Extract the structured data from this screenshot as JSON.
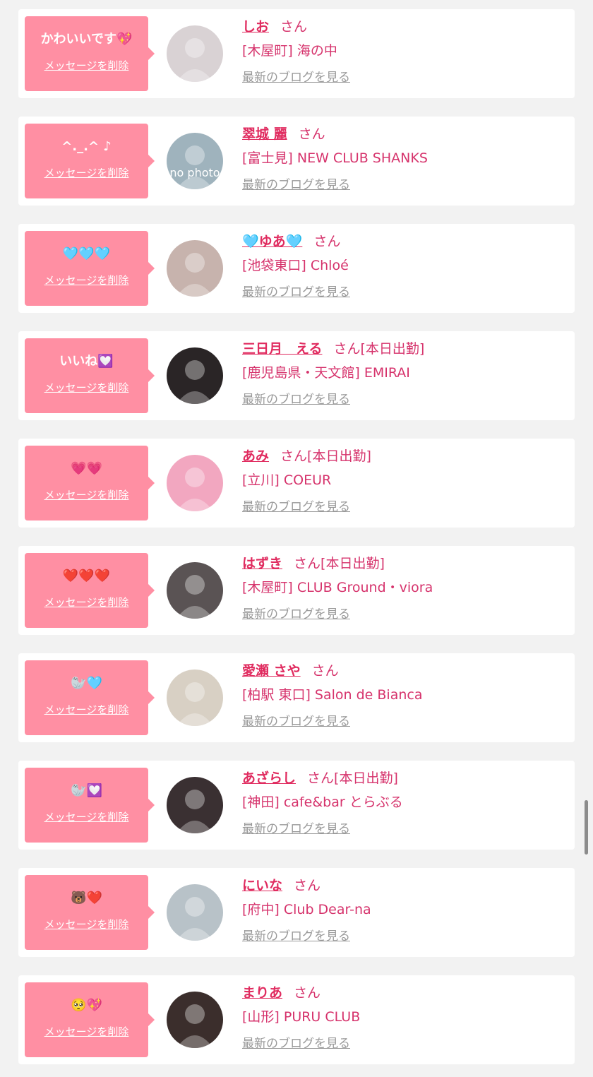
{
  "labels": {
    "delete": "メッセージを削除",
    "san": "さん",
    "blog": "最新のブログを見る"
  },
  "cards": [
    {
      "message": "かわいいです💖",
      "name": "しお",
      "status": "",
      "shop": "[木屋町] 海の中",
      "avatar_color": "#d9d2d4",
      "avatar_text": ""
    },
    {
      "message": "^._.^ ♪",
      "name": "翠城 麗",
      "status": "",
      "shop": "[富士見] NEW CLUB SHANKS",
      "avatar_color": "#9fb3bd",
      "avatar_text": "no photo"
    },
    {
      "message": "🩵🩵🩵",
      "name": "🩵ゆあ🩵",
      "status": "",
      "shop": "[池袋東口] Chloé",
      "avatar_color": "#c7b3ad",
      "avatar_text": ""
    },
    {
      "message": "いいね💟",
      "name": "三日月　える",
      "status": "[本日出勤]",
      "shop": "[鹿児島県・天文館] EMIRAI",
      "avatar_color": "#2a2526",
      "avatar_text": ""
    },
    {
      "message": "💗💗",
      "name": "あみ",
      "status": "[本日出勤]",
      "shop": "[立川] COEUR",
      "avatar_color": "#f2a7c0",
      "avatar_text": ""
    },
    {
      "message": "❤️❤️❤️",
      "name": "はずき",
      "status": "[本日出勤]",
      "shop": "[木屋町] CLUB Ground・viora",
      "avatar_color": "#5a5354",
      "avatar_text": ""
    },
    {
      "message": "🦭🩵",
      "name": "愛瀬 さや",
      "status": "",
      "shop": "[柏駅 東口] Salon de Bianca",
      "avatar_color": "#d8d0c4",
      "avatar_text": ""
    },
    {
      "message": "🦭💟",
      "name": "あざらし",
      "status": "[本日出勤]",
      "shop": "[神田] cafe&bar とらぶる",
      "avatar_color": "#3a3032",
      "avatar_text": ""
    },
    {
      "message": "🐻❤️",
      "name": "にいな",
      "status": "",
      "shop": "[府中] Club Dear-na",
      "avatar_color": "#b8c2c8",
      "avatar_text": ""
    },
    {
      "message": "🥺💖",
      "name": "まりあ",
      "status": "",
      "shop": "[山形] PURU CLUB",
      "avatar_color": "#3b2e2c",
      "avatar_text": ""
    }
  ]
}
